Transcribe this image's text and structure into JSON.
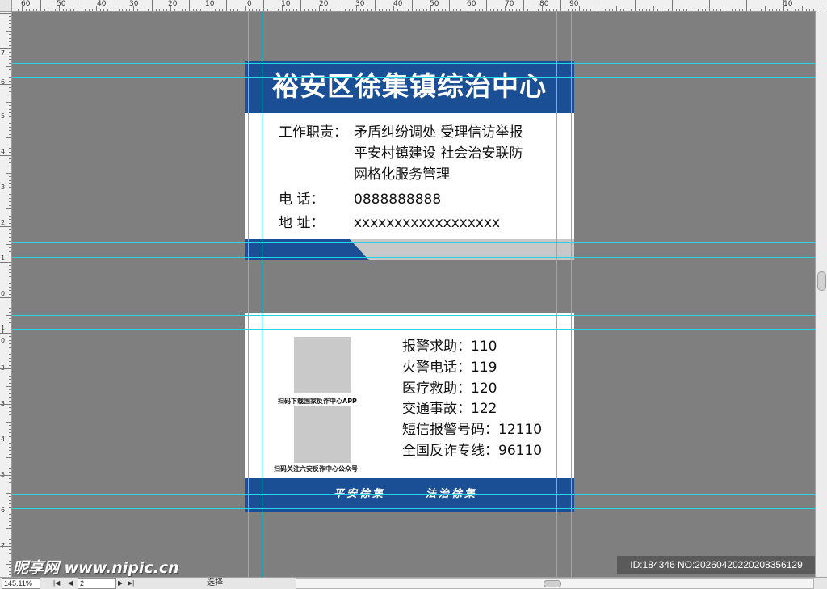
{
  "ruler": {
    "top_labels": [
      "60",
      "50",
      "40",
      "30",
      "20",
      "10",
      "0",
      "10",
      "20",
      "30",
      "40",
      "50",
      "60",
      "70",
      "80",
      "90",
      "10"
    ],
    "left_labels": [
      "7",
      "6",
      "5",
      "4",
      "3",
      "2",
      "1",
      "0",
      "1",
      "0",
      "1",
      "2",
      "3",
      "4",
      "5",
      "6",
      "7"
    ]
  },
  "card_front": {
    "title": "裕安区徐集镇综治中心",
    "duty_label": "工作职责：",
    "duty_line1": "矛盾纠纷调处  受理信访举报",
    "duty_line2": "平安村镇建设  社会治安联防",
    "duty_line3": "网格化服务管理",
    "phone_label": "电      话：",
    "phone_value": "0888888888",
    "address_label": "地      址：",
    "address_value": "xxxxxxxxxxxxxxxxxx"
  },
  "card_back": {
    "qr_caption_1": "扫码下载国家反诈中心APP",
    "qr_caption_2": "扫码关注六安反诈中心公众号",
    "hotlines": [
      "报警求助：110",
      "火警电话：119",
      "医疗救助：120",
      "交通事故：122",
      "短信报警号码：12110",
      "全国反诈专线：96110"
    ],
    "slogan_1": "平安徐集",
    "slogan_2": "法治徐集"
  },
  "statusbar": {
    "zoom": "145.11%",
    "page": "2",
    "nav_first": "|◀",
    "nav_prev": "◀",
    "nav_next": "▶",
    "nav_last": "▶|",
    "tool_status": "选择"
  },
  "watermark": {
    "logo": "昵享网 www.nipic.cn",
    "id_text": "ID:184346 NO:20260420220208356129"
  },
  "colors": {
    "card_blue": "#1a4e95",
    "guide": "#25d7e6",
    "canvas": "#7f7f7f",
    "qr_placeholder": "#c9c9c9"
  }
}
